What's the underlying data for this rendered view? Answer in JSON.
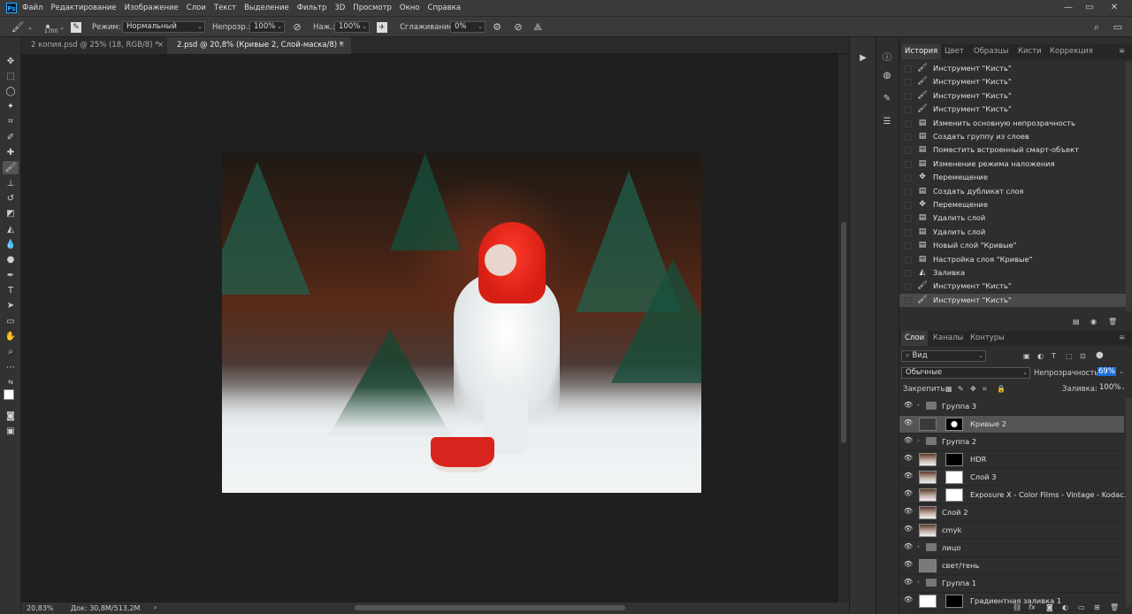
{
  "app": {
    "logo": "Ps"
  },
  "menu": [
    "Файл",
    "Редактирование",
    "Изображение",
    "Слои",
    "Текст",
    "Выделение",
    "Фильтр",
    "3D",
    "Просмотр",
    "Окно",
    "Справка"
  ],
  "options": {
    "brush_size": "1700",
    "mode_label": "Режим:",
    "mode_value": "Нормальный",
    "opacity_label": "Непрозр.:",
    "opacity_value": "100%",
    "flow_label": "Наж.:",
    "flow_value": "100%",
    "smoothing_label": "Сглаживание:",
    "smoothing_value": "0%"
  },
  "tabs": [
    {
      "label": "2 копия.psd @ 25% (18, RGB/8) *",
      "active": false
    },
    {
      "label": "2.psd @ 20,8% (Кривые 2, Слой-маска/8) *",
      "active": true
    }
  ],
  "status": {
    "zoom": "20,83%",
    "doc": "Док: 30,8M/513,2M"
  },
  "history_panel": {
    "tabs": [
      "История",
      "Цвет",
      "Образцы",
      "Кисти",
      "Коррекция"
    ],
    "rows": [
      {
        "icon": "brush",
        "label": "Инструмент \"Кисть\""
      },
      {
        "icon": "brush",
        "label": "Инструмент \"Кисть\""
      },
      {
        "icon": "brush",
        "label": "Инструмент \"Кисть\""
      },
      {
        "icon": "brush",
        "label": "Инструмент \"Кисть\""
      },
      {
        "icon": "doc",
        "label": "Изменить основную непрозрачность"
      },
      {
        "icon": "doc",
        "label": "Создать группу из слоев"
      },
      {
        "icon": "doc",
        "label": "Поместить встроенный смарт-объект"
      },
      {
        "icon": "doc",
        "label": "Изменение режима наложения"
      },
      {
        "icon": "move",
        "label": "Перемещение"
      },
      {
        "icon": "doc",
        "label": "Создать дубликат слоя"
      },
      {
        "icon": "move",
        "label": "Перемещение"
      },
      {
        "icon": "doc",
        "label": "Удалить слой"
      },
      {
        "icon": "doc",
        "label": "Удалить слой"
      },
      {
        "icon": "doc",
        "label": "Новый слой \"Кривые\""
      },
      {
        "icon": "doc",
        "label": "Настройка слоя \"Кривые\""
      },
      {
        "icon": "fill",
        "label": "Заливка"
      },
      {
        "icon": "brush",
        "label": "Инструмент \"Кисть\""
      },
      {
        "icon": "brush",
        "label": "Инструмент \"Кисть\""
      }
    ]
  },
  "layers_panel": {
    "tabs": [
      "Слои",
      "Каналы",
      "Контуры"
    ],
    "filter_label": "Вид",
    "blend_mode": "Обычные",
    "opacity_label": "Непрозрачность:",
    "opacity_value": "69%",
    "lock_label": "Закрепить:",
    "fill_label": "Заливка:",
    "fill_value": "100%",
    "layers": [
      {
        "name": "Группа 3",
        "type": "group"
      },
      {
        "name": "Кривые 2",
        "type": "curves",
        "selected": true
      },
      {
        "name": "Группа 2",
        "type": "group"
      },
      {
        "name": "HDR",
        "type": "masked"
      },
      {
        "name": "Слой 3",
        "type": "masked"
      },
      {
        "name": "Exposure X - Color Films - Vintage - Kodac...",
        "type": "masked"
      },
      {
        "name": "Слой 2",
        "type": "photo"
      },
      {
        "name": "cmyk",
        "type": "photo"
      },
      {
        "name": "лицо",
        "type": "group"
      },
      {
        "name": "свет/тень",
        "type": "gray"
      },
      {
        "name": "Группа 1",
        "type": "group"
      },
      {
        "name": "Градиентная заливка 1",
        "type": "gradient"
      }
    ]
  },
  "icons": {
    "brush": "brush-icon",
    "move": "move-icon",
    "eye": "eye-icon"
  },
  "colors": {
    "accent": "#31a8ff",
    "selection": "#555555",
    "opacity_highlight": "#1d6fd8"
  }
}
